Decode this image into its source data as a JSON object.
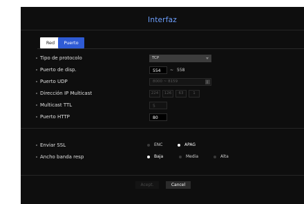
{
  "window": {
    "title": "Interfaz"
  },
  "tabs": [
    {
      "label": "Red",
      "active": false
    },
    {
      "label": "Puerto",
      "active": true
    }
  ],
  "settings": {
    "protocol": {
      "label": "Tipo de protocolo",
      "value": "TCP"
    },
    "disp_port": {
      "label": "Puerto de disp.",
      "value": "554",
      "range_sep": "~",
      "range_end": "558"
    },
    "udp_port": {
      "label": "Puerto UDP",
      "value": "8000 ~ 8159"
    },
    "multicast_ip": {
      "label": "Dirección IP Multicast",
      "octets": [
        "224",
        "126",
        "63",
        "1"
      ]
    },
    "multicast_ttl": {
      "label": "Multicast TTL",
      "value": "5"
    },
    "http_port": {
      "label": "Puerto HTTP",
      "value": "80"
    }
  },
  "ssl": {
    "label": "Enviar SSL",
    "options": [
      {
        "label": "ENC",
        "selected": false
      },
      {
        "label": "APAG",
        "selected": true
      }
    ]
  },
  "bandwidth": {
    "label": "Ancho banda resp",
    "options": [
      {
        "label": "Baja",
        "selected": true
      },
      {
        "label": "Media",
        "selected": false
      },
      {
        "label": "Alta",
        "selected": false
      }
    ]
  },
  "buttons": {
    "accept": "Acept.",
    "cancel": "Cancel"
  },
  "colors": {
    "title": "#6ea0ff",
    "tab_active": "#2f5bd4",
    "background": "#0e0e0e"
  }
}
